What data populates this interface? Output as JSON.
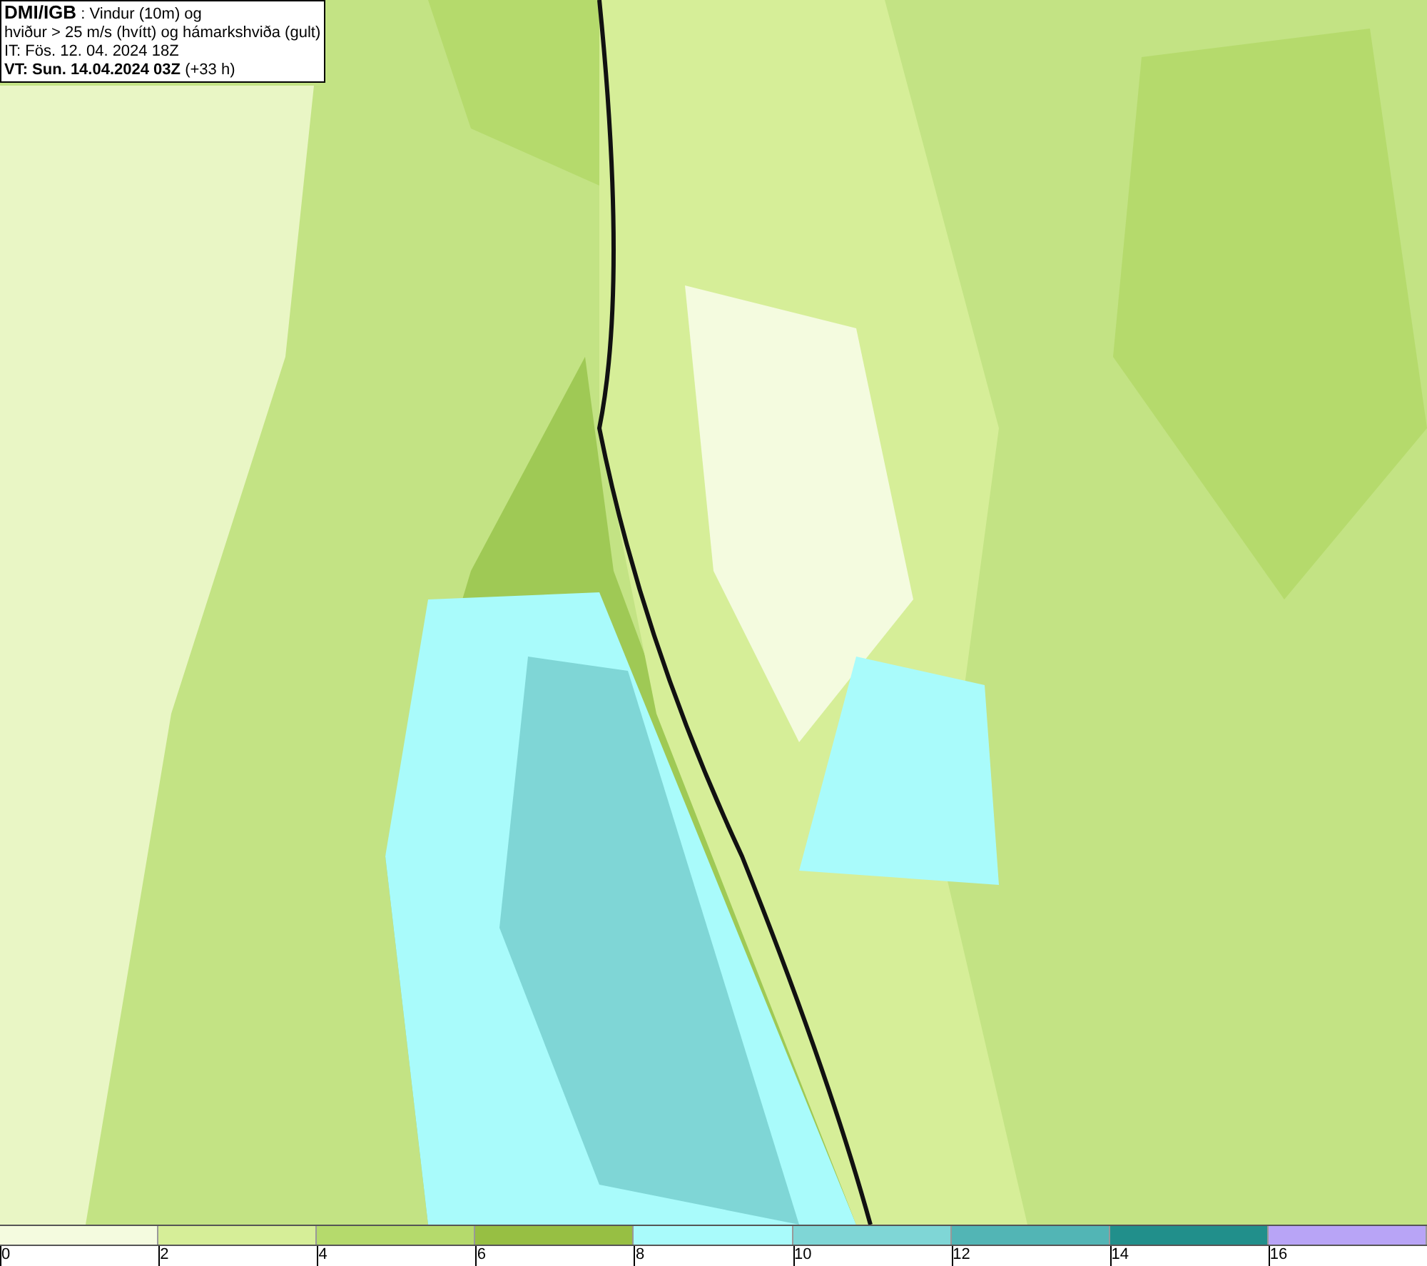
{
  "header": {
    "source": "DMI/IGB",
    "title": ": Vindur (10m) og",
    "line_2": "hviður > 25 m/s (hvítt) og hámarkshviða (gult)",
    "issue_time": "IT: Fös. 12. 04. 2024 18Z",
    "valid_time": "VT: Sun. 14.04.2024 03Z",
    "lead_time": "(+33 h)"
  },
  "legend": {
    "bins": [
      {
        "color": "#f4fbdf"
      },
      {
        "color": "#d6ee98"
      },
      {
        "color": "#b5da6c"
      },
      {
        "color": "#97bf43"
      },
      {
        "color": "#a9fbfb"
      },
      {
        "color": "#7fd6d6"
      },
      {
        "color": "#52b5b5"
      },
      {
        "color": "#218f8b"
      },
      {
        "color": "#b8a4f6"
      }
    ],
    "ticks": [
      "0",
      "2",
      "4",
      "6",
      "8",
      "10",
      "12",
      "14",
      "16"
    ]
  }
}
